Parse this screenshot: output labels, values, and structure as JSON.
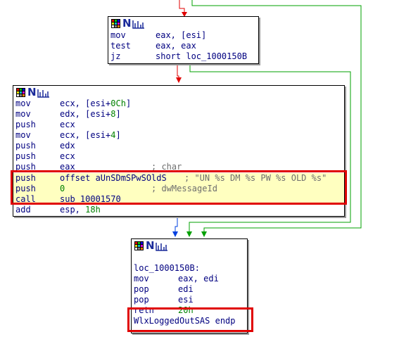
{
  "block1": {
    "lines": [
      {
        "mn": "mov",
        "op": "eax, [esi]"
      },
      {
        "mn": "test",
        "op": "eax, eax"
      },
      {
        "mn": "jz",
        "op": "short loc_1000150B"
      }
    ]
  },
  "block2": {
    "lines": [
      {
        "mn": "mov",
        "op_pre": "ecx, [esi+",
        "op_num": "0Ch",
        "op_post": "]"
      },
      {
        "mn": "mov",
        "op_pre": "edx, [esi+",
        "op_num": "8",
        "op_post": "]"
      },
      {
        "mn": "push",
        "op": "ecx"
      },
      {
        "mn": "mov",
        "op_pre": "ecx, [esi+",
        "op_num": "4",
        "op_post": "]"
      },
      {
        "mn": "push",
        "op": "edx"
      },
      {
        "mn": "push",
        "op": "ecx"
      },
      {
        "mn": "push",
        "op": "eax",
        "cmt": "; char"
      },
      {
        "mn": "push",
        "op": "offset aUnSDmSPwSOldS",
        "cmt": "; \"UN %s DM %s PW %s OLD %s\""
      },
      {
        "mn": "push",
        "op_num": "0",
        "cmt": "; dwMessageId"
      },
      {
        "mn": "call",
        "op": "sub_10001570"
      },
      {
        "mn": "add",
        "op_pre": "esp, ",
        "op_num": "18h"
      }
    ]
  },
  "block3": {
    "label": "loc_1000150B:",
    "lines": [
      {
        "mn": "mov",
        "op": "eax, edi"
      },
      {
        "mn": "pop",
        "op": "edi"
      },
      {
        "mn": "pop",
        "op": "esi"
      },
      {
        "mn": "retn",
        "op_num": "20h"
      }
    ],
    "endp": "WlxLoggedOutSAS endp"
  },
  "colors": {
    "edge_red": "#e00000",
    "edge_green": "#00a000",
    "edge_blue": "#0040e0",
    "text": "#000080",
    "number": "#008000",
    "comment": "#6e6e6e",
    "highlight_box": "#e00000",
    "selected_bg": "#ffffc0"
  },
  "icons": [
    "color-palette-icon",
    "node-n-icon",
    "graph-view-icon"
  ]
}
